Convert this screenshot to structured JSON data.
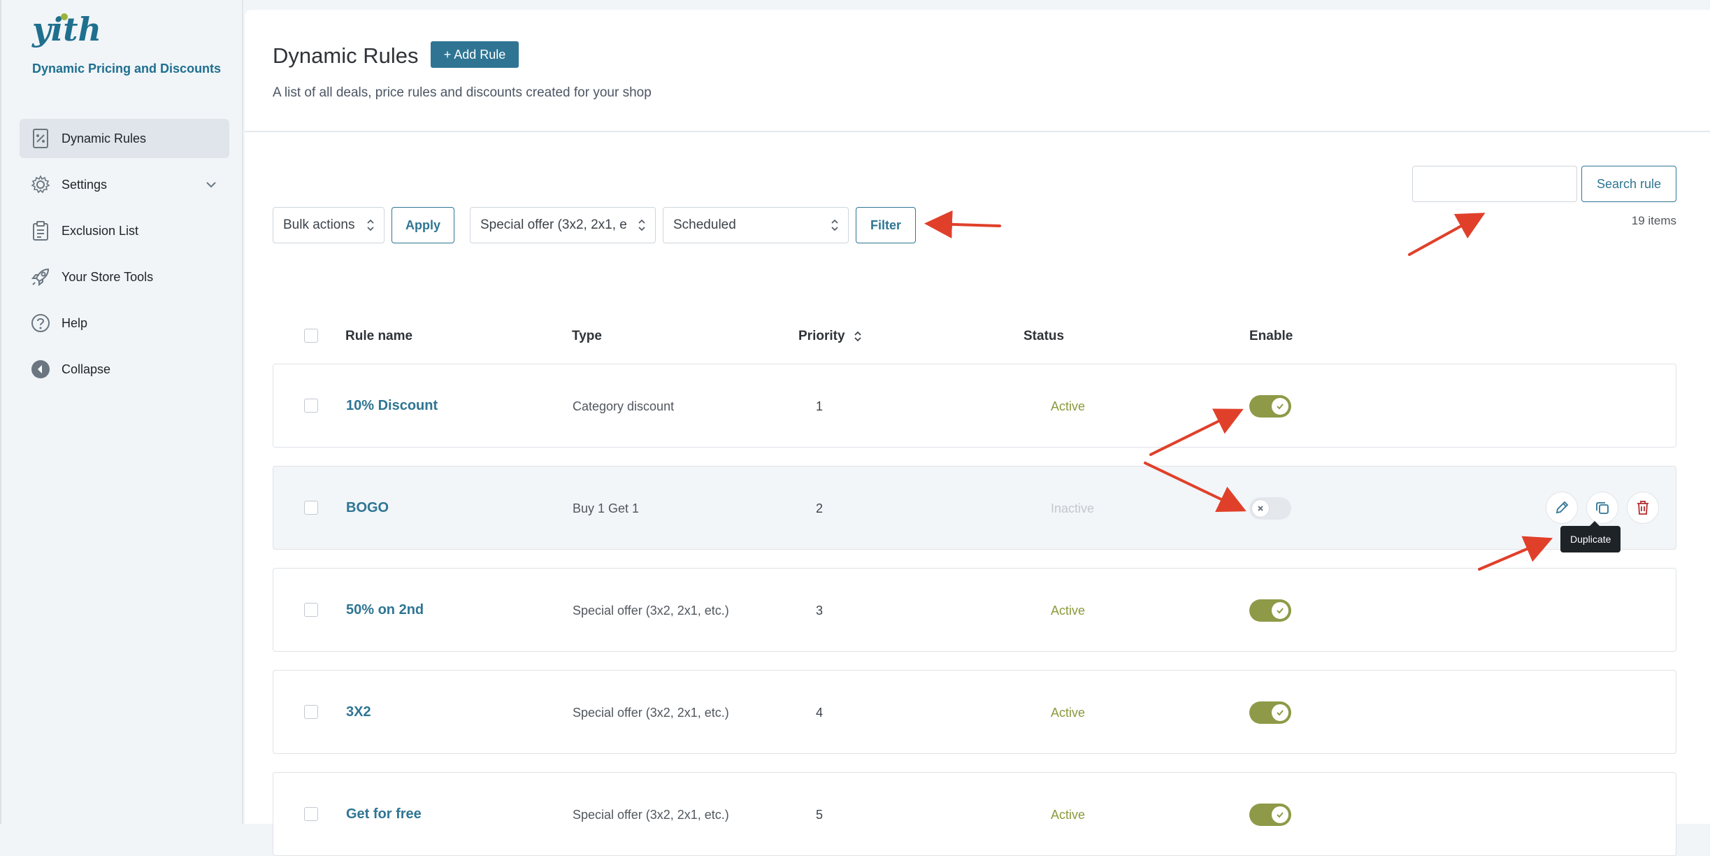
{
  "brand": {
    "name": "Dynamic Pricing and Discounts"
  },
  "sidebar": {
    "items": [
      {
        "label": "Dynamic Rules",
        "icon": "discount-tag-icon"
      },
      {
        "label": "Settings",
        "icon": "gear-icon"
      },
      {
        "label": "Exclusion List",
        "icon": "clipboard-icon"
      },
      {
        "label": "Your Store Tools",
        "icon": "rocket-icon"
      },
      {
        "label": "Help",
        "icon": "help-icon"
      },
      {
        "label": "Collapse",
        "icon": "collapse-icon"
      }
    ]
  },
  "header": {
    "title": "Dynamic Rules",
    "add_rule": "+ Add Rule",
    "description": "A list of all deals, price rules and discounts created for your shop"
  },
  "toolbar": {
    "bulk_actions": "Bulk actions",
    "apply": "Apply",
    "type_filter": "Special offer (3x2, 2x1, e",
    "status_filter": "Scheduled",
    "filter": "Filter",
    "search_button": "Search rule",
    "search_value": "",
    "items_count": "19 items"
  },
  "table": {
    "columns": [
      "Rule name",
      "Type",
      "Priority",
      "Status",
      "Enable"
    ],
    "rows": [
      {
        "name": "10% Discount",
        "type": "Category discount",
        "priority": "1",
        "status": "Active",
        "enabled": true
      },
      {
        "name": "BOGO",
        "type": "Buy 1 Get 1",
        "priority": "2",
        "status": "Inactive",
        "enabled": false
      },
      {
        "name": "50% on 2nd",
        "type": "Special offer (3x2, 2x1, etc.)",
        "priority": "3",
        "status": "Active",
        "enabled": true
      },
      {
        "name": "3X2",
        "type": "Special offer (3x2, 2x1, etc.)",
        "priority": "4",
        "status": "Active",
        "enabled": true
      },
      {
        "name": "Get for free",
        "type": "Special offer (3x2, 2x1, etc.)",
        "priority": "5",
        "status": "Active",
        "enabled": true
      }
    ],
    "tooltip": "Duplicate"
  },
  "colors": {
    "accent": "#2f7593",
    "toggle_on": "#8e9a47",
    "status_active": "#8a9a3b",
    "status_inactive": "#c3c8ce",
    "annotation_arrow": "#e0402a"
  }
}
